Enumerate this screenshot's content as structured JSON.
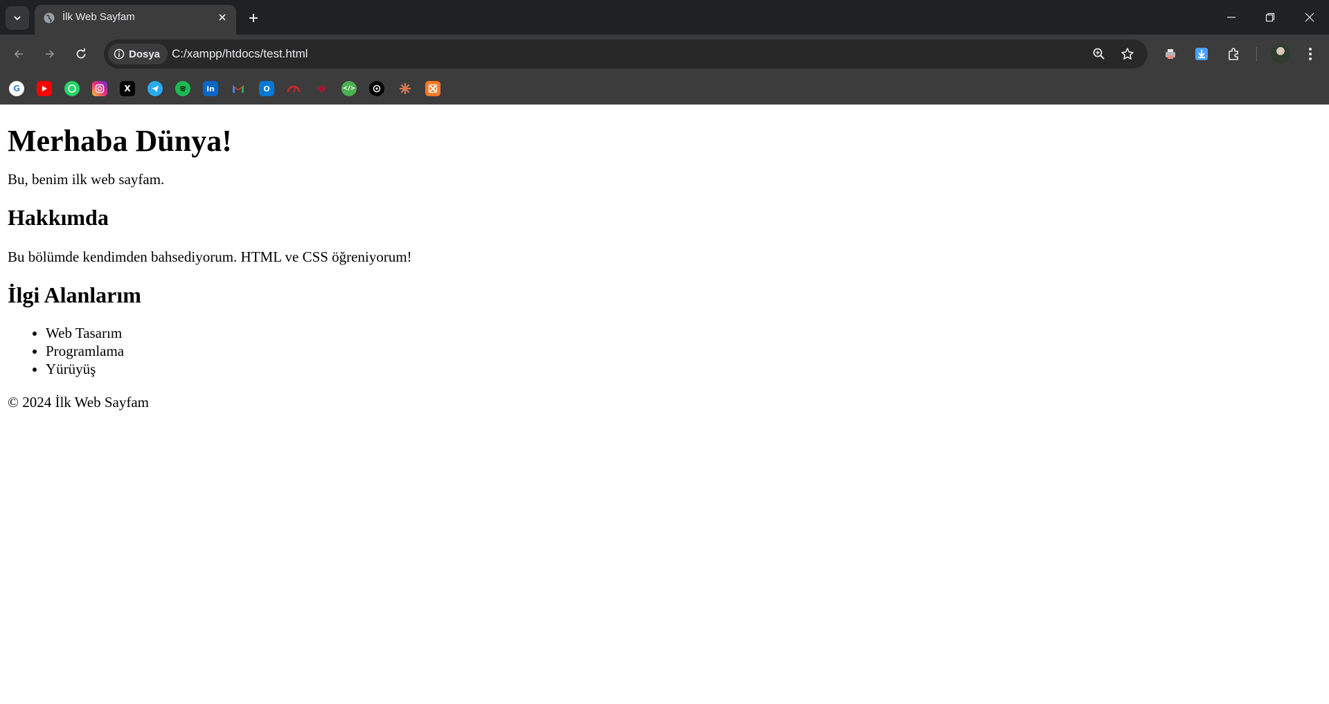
{
  "browser": {
    "tab": {
      "title": "İlk Web Sayfam"
    },
    "address_bar": {
      "site_chip_label": "Dosya",
      "url": "C:/xampp/htdocs/test.html"
    },
    "bookmarks": [
      {
        "name": "google-icon",
        "color": "#ffffff"
      },
      {
        "name": "youtube-icon",
        "color": "#ff0000"
      },
      {
        "name": "whatsapp-icon",
        "color": "#25d366"
      },
      {
        "name": "instagram-icon",
        "color": "#e1306c"
      },
      {
        "name": "x-icon",
        "color": "#000000"
      },
      {
        "name": "telegram-icon",
        "color": "#2aabee"
      },
      {
        "name": "spotify-icon",
        "color": "#1db954"
      },
      {
        "name": "linkedin-icon",
        "color": "#0a66c2"
      },
      {
        "name": "gmail-icon",
        "color": "#ea4335"
      },
      {
        "name": "outlook-icon",
        "color": "#0078d4"
      },
      {
        "name": "speedtest-icon",
        "color": "#c62828"
      },
      {
        "name": "huawei-icon",
        "color": "#cf0a2c"
      },
      {
        "name": "code-icon",
        "color": "#4caf50"
      },
      {
        "name": "chatgpt-icon",
        "color": "#000000"
      },
      {
        "name": "claude-icon",
        "color": "#d97757"
      },
      {
        "name": "xampp-icon",
        "color": "#fb7a24"
      }
    ]
  },
  "page": {
    "heading": "Merhaba Dünya!",
    "intro": "Bu, benim ilk web sayfam.",
    "about": {
      "heading": "Hakkımda",
      "text": "Bu bölümde kendimden bahsediyorum. HTML ve CSS öğreniyorum!"
    },
    "interests": {
      "heading": "İlgi Alanlarım",
      "items": [
        "Web Tasarım",
        "Programlama",
        "Yürüyüş"
      ]
    },
    "footer": "© 2024 İlk Web Sayfam"
  }
}
